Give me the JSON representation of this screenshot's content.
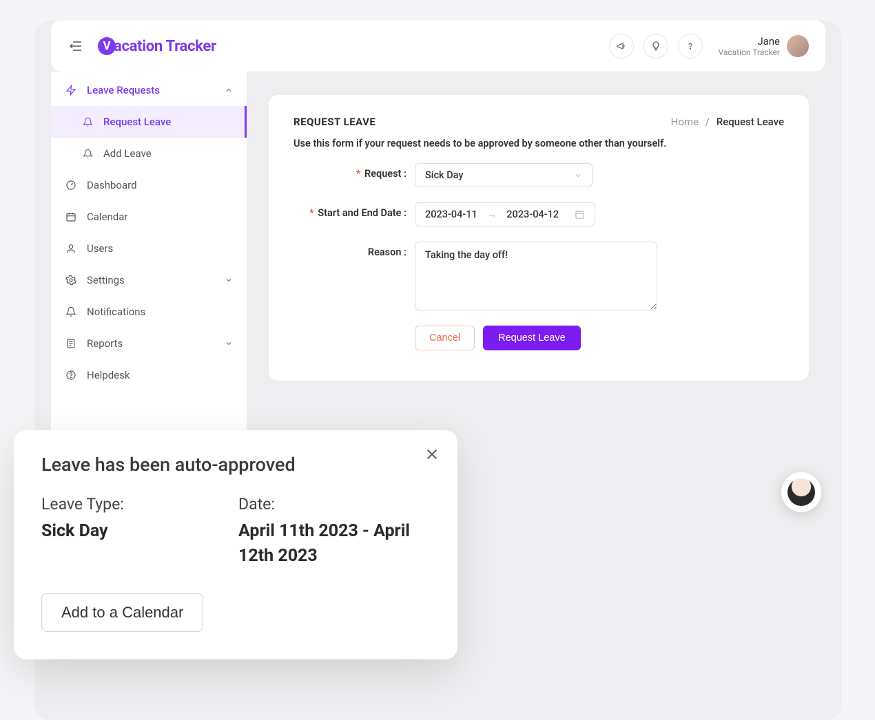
{
  "header": {
    "brand": "acation Tracker",
    "user_name": "Jane",
    "user_org": "Vacation Tracker"
  },
  "sidebar": {
    "parent_label": "Leave Requests",
    "items": [
      {
        "label": "Request Leave"
      },
      {
        "label": "Add Leave"
      },
      {
        "label": "Dashboard"
      },
      {
        "label": "Calendar"
      },
      {
        "label": "Users"
      },
      {
        "label": "Settings"
      },
      {
        "label": "Notifications"
      },
      {
        "label": "Reports"
      },
      {
        "label": "Helpdesk"
      }
    ]
  },
  "breadcrumb": {
    "home": "Home",
    "sep": "/",
    "current": "Request Leave"
  },
  "page": {
    "title": "REQUEST LEAVE",
    "instructions": "Use this form if your request needs to be approved by someone other than yourself."
  },
  "form": {
    "request_label": "Request",
    "request_value": "Sick Day",
    "date_label": "Start and End Date",
    "date_start": "2023-04-11",
    "date_end": "2023-04-12",
    "reason_label": "Reason",
    "reason_value": "Taking the day off!",
    "cancel": "Cancel",
    "submit": "Request Leave"
  },
  "toast": {
    "title": "Leave has been auto-approved",
    "type_label": "Leave Type:",
    "type_value": "Sick Day",
    "date_label": "Date:",
    "date_value": "April 11th 2023 - April 12th 2023",
    "add_calendar": "Add to a Calendar"
  }
}
